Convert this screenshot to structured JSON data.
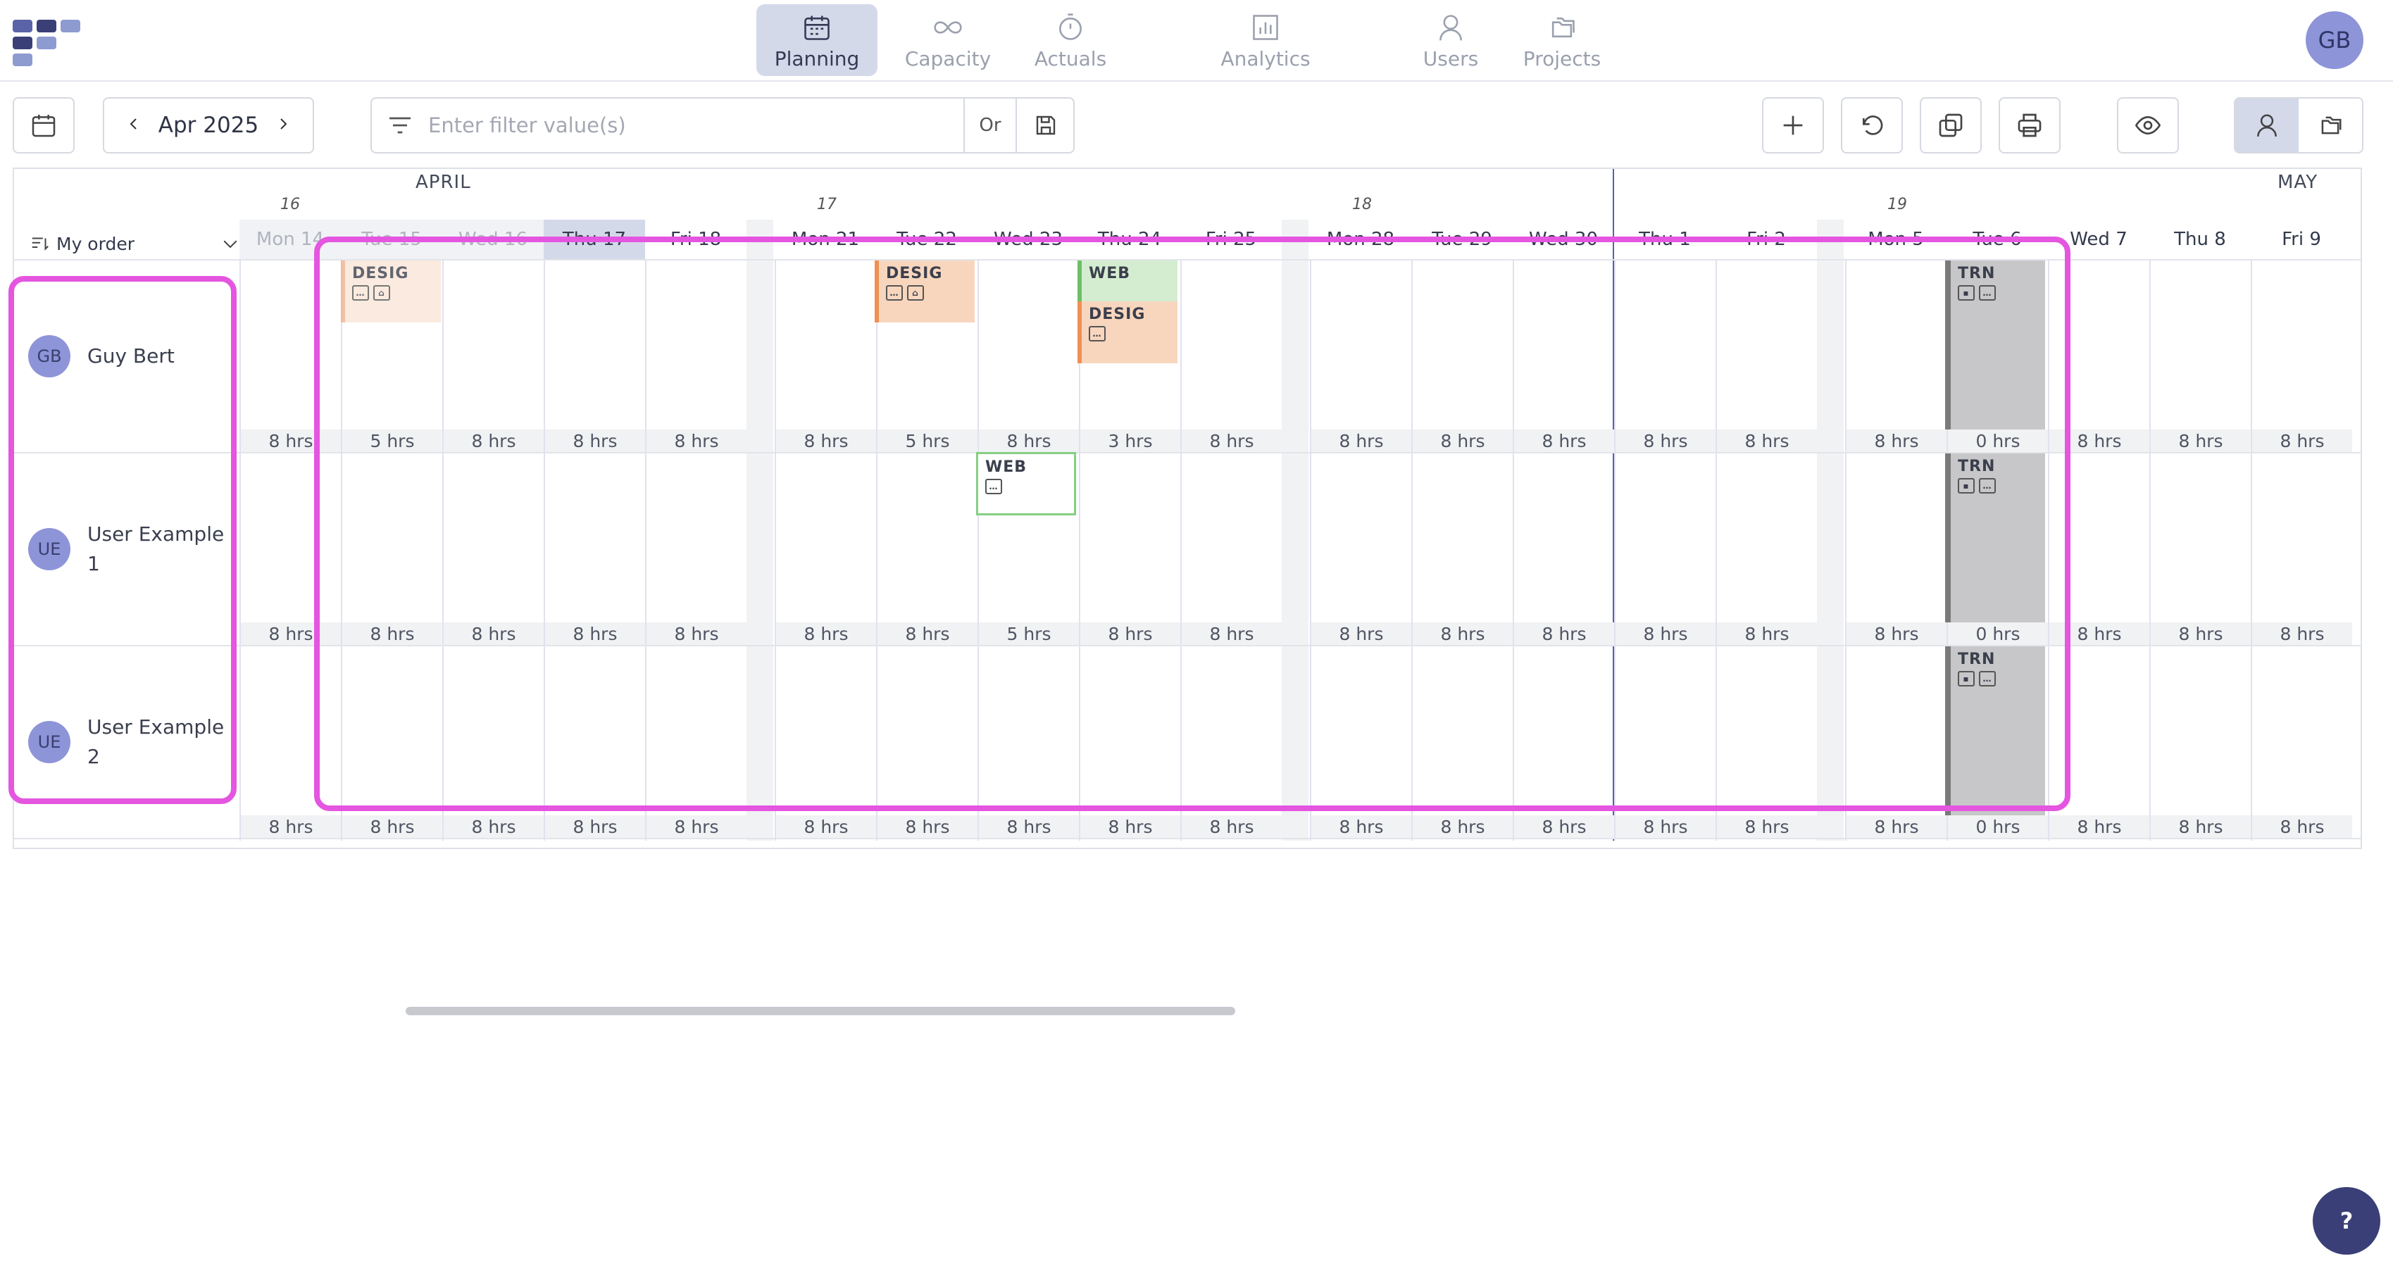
{
  "nav": {
    "items": [
      {
        "label": "Planning",
        "active": true
      },
      {
        "label": "Capacity"
      },
      {
        "label": "Actuals"
      },
      {
        "label": "Analytics"
      },
      {
        "label": "Users"
      },
      {
        "label": "Projects"
      }
    ],
    "avatar": "GB"
  },
  "toolbar": {
    "month": "Apr 2025",
    "filter_placeholder": "Enter filter value(s)",
    "or_label": "Or"
  },
  "grid": {
    "months": [
      "APRIL",
      "MAY"
    ],
    "weeks": [
      "16",
      "17",
      "18",
      "19"
    ],
    "order_label": "My order",
    "days": [
      "Mon 14",
      "Tue 15",
      "Wed 16",
      "Thu 17",
      "Fri 18",
      "Mon 21",
      "Tue 22",
      "Wed 23",
      "Thu 24",
      "Fri 25",
      "Mon 28",
      "Tue 29",
      "Wed 30",
      "Thu 1",
      "Fri 2",
      "Mon 5",
      "Tue 6",
      "Wed 7",
      "Thu 8",
      "Fri 9"
    ],
    "users": [
      {
        "initials": "GB",
        "name": "Guy Bert",
        "hours": [
          "8 hrs",
          "5 hrs",
          "8 hrs",
          "8 hrs",
          "8 hrs",
          "8 hrs",
          "5 hrs",
          "8 hrs",
          "3 hrs",
          "8 hrs",
          "8 hrs",
          "8 hrs",
          "8 hrs",
          "8 hrs",
          "8 hrs",
          "8 hrs",
          "0 hrs",
          "8 hrs",
          "8 hrs",
          "8 hrs"
        ]
      },
      {
        "initials": "UE",
        "name": "User Example 1",
        "hours": [
          "8 hrs",
          "8 hrs",
          "8 hrs",
          "8 hrs",
          "8 hrs",
          "8 hrs",
          "8 hrs",
          "5 hrs",
          "8 hrs",
          "8 hrs",
          "8 hrs",
          "8 hrs",
          "8 hrs",
          "8 hrs",
          "8 hrs",
          "8 hrs",
          "0 hrs",
          "8 hrs",
          "8 hrs",
          "8 hrs"
        ]
      },
      {
        "initials": "UE",
        "name": "User Example 2",
        "hours": [
          "8 hrs",
          "8 hrs",
          "8 hrs",
          "8 hrs",
          "8 hrs",
          "8 hrs",
          "8 hrs",
          "8 hrs",
          "8 hrs",
          "8 hrs",
          "8 hrs",
          "8 hrs",
          "8 hrs",
          "8 hrs",
          "8 hrs",
          "8 hrs",
          "0 hrs",
          "8 hrs",
          "8 hrs",
          "8 hrs"
        ]
      }
    ],
    "tasks": {
      "desig": "DESIG",
      "web": "WEB",
      "trn": "TRN"
    }
  },
  "help": "?"
}
